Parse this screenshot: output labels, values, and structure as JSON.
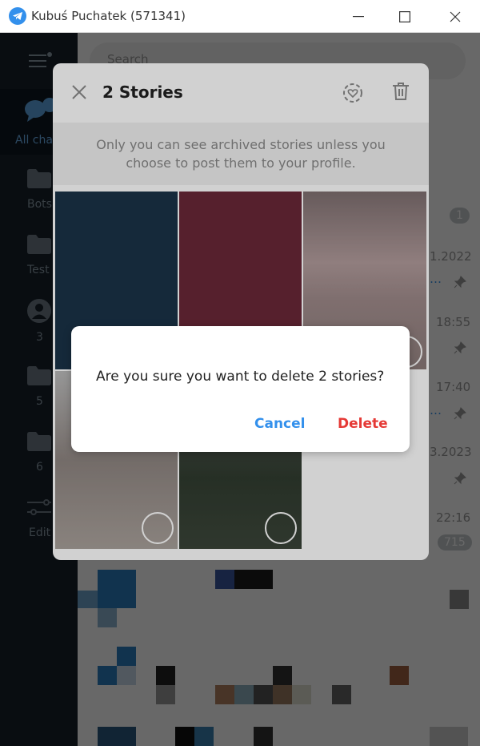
{
  "window": {
    "title": "Kubuś Puchatek (571341)"
  },
  "sidebar": {
    "items": [
      {
        "label": "All chats",
        "icon": "chats-icon"
      },
      {
        "label": "Bots",
        "icon": "folder-icon"
      },
      {
        "label": "Test",
        "icon": "folder-icon"
      },
      {
        "label": "3",
        "icon": "person-icon"
      },
      {
        "label": "5",
        "icon": "folder-icon"
      },
      {
        "label": "6",
        "icon": "folder-icon"
      },
      {
        "label": "Edit",
        "icon": "sliders-icon"
      }
    ]
  },
  "main": {
    "search_placeholder": "Search",
    "meta": {
      "unread1": "1",
      "date1": "1.2022",
      "time2": "18:55",
      "time3": "17:40",
      "date4": "3.2023",
      "time5": "22:16",
      "count5": "715"
    }
  },
  "stories": {
    "title": "2 Stories",
    "notice_line1": "Only you can see archived stories unless you",
    "notice_line2": "choose to post them to your profile."
  },
  "dialog": {
    "message": "Are you sure you want to delete 2 stories?",
    "cancel": "Cancel",
    "delete": "Delete"
  },
  "colors": {
    "accent": "#3390ec",
    "danger": "#e53935",
    "sidebar": "#17212b"
  }
}
